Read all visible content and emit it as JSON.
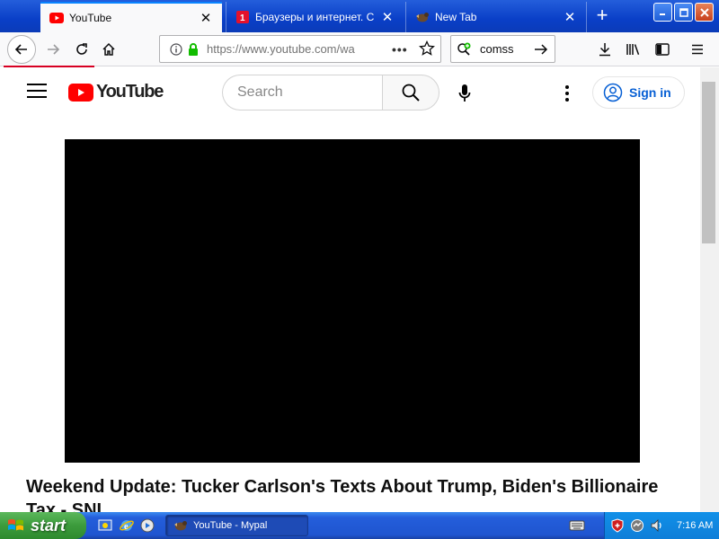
{
  "browser": {
    "tabs": [
      {
        "title": "YouTube",
        "favicon": "youtube-favicon",
        "active": true
      },
      {
        "title": "Браузеры и интернет. Скач",
        "favicon": "red-site-favicon",
        "active": false
      },
      {
        "title": "New Tab",
        "favicon": "mypal-favicon",
        "active": false
      }
    ],
    "close_glyph": "✕",
    "new_tab_glyph": "+",
    "url": "https://www.youtube.com/wa",
    "search_value": "comss",
    "page_actions_glyph": "•••",
    "load_progress_fraction": 0.13
  },
  "youtube": {
    "logo_text": "YouTube",
    "search_placeholder": "Search",
    "signin_label": "Sign in",
    "video_title": "Weekend Update: Tucker Carlson's Texts About Trump, Biden's Billionaire Tax - SNL"
  },
  "taskbar": {
    "start_label": "start",
    "task_label": "YouTube - Mypal",
    "clock": "7:16 AM"
  },
  "colors": {
    "accent_blue": "#0a84ff",
    "youtube_red": "#ff0000",
    "progress_red": "#d70022",
    "signin_blue": "#065fd4",
    "xp_taskbar": "#245edb",
    "xp_start_green": "#3c9b3c"
  }
}
